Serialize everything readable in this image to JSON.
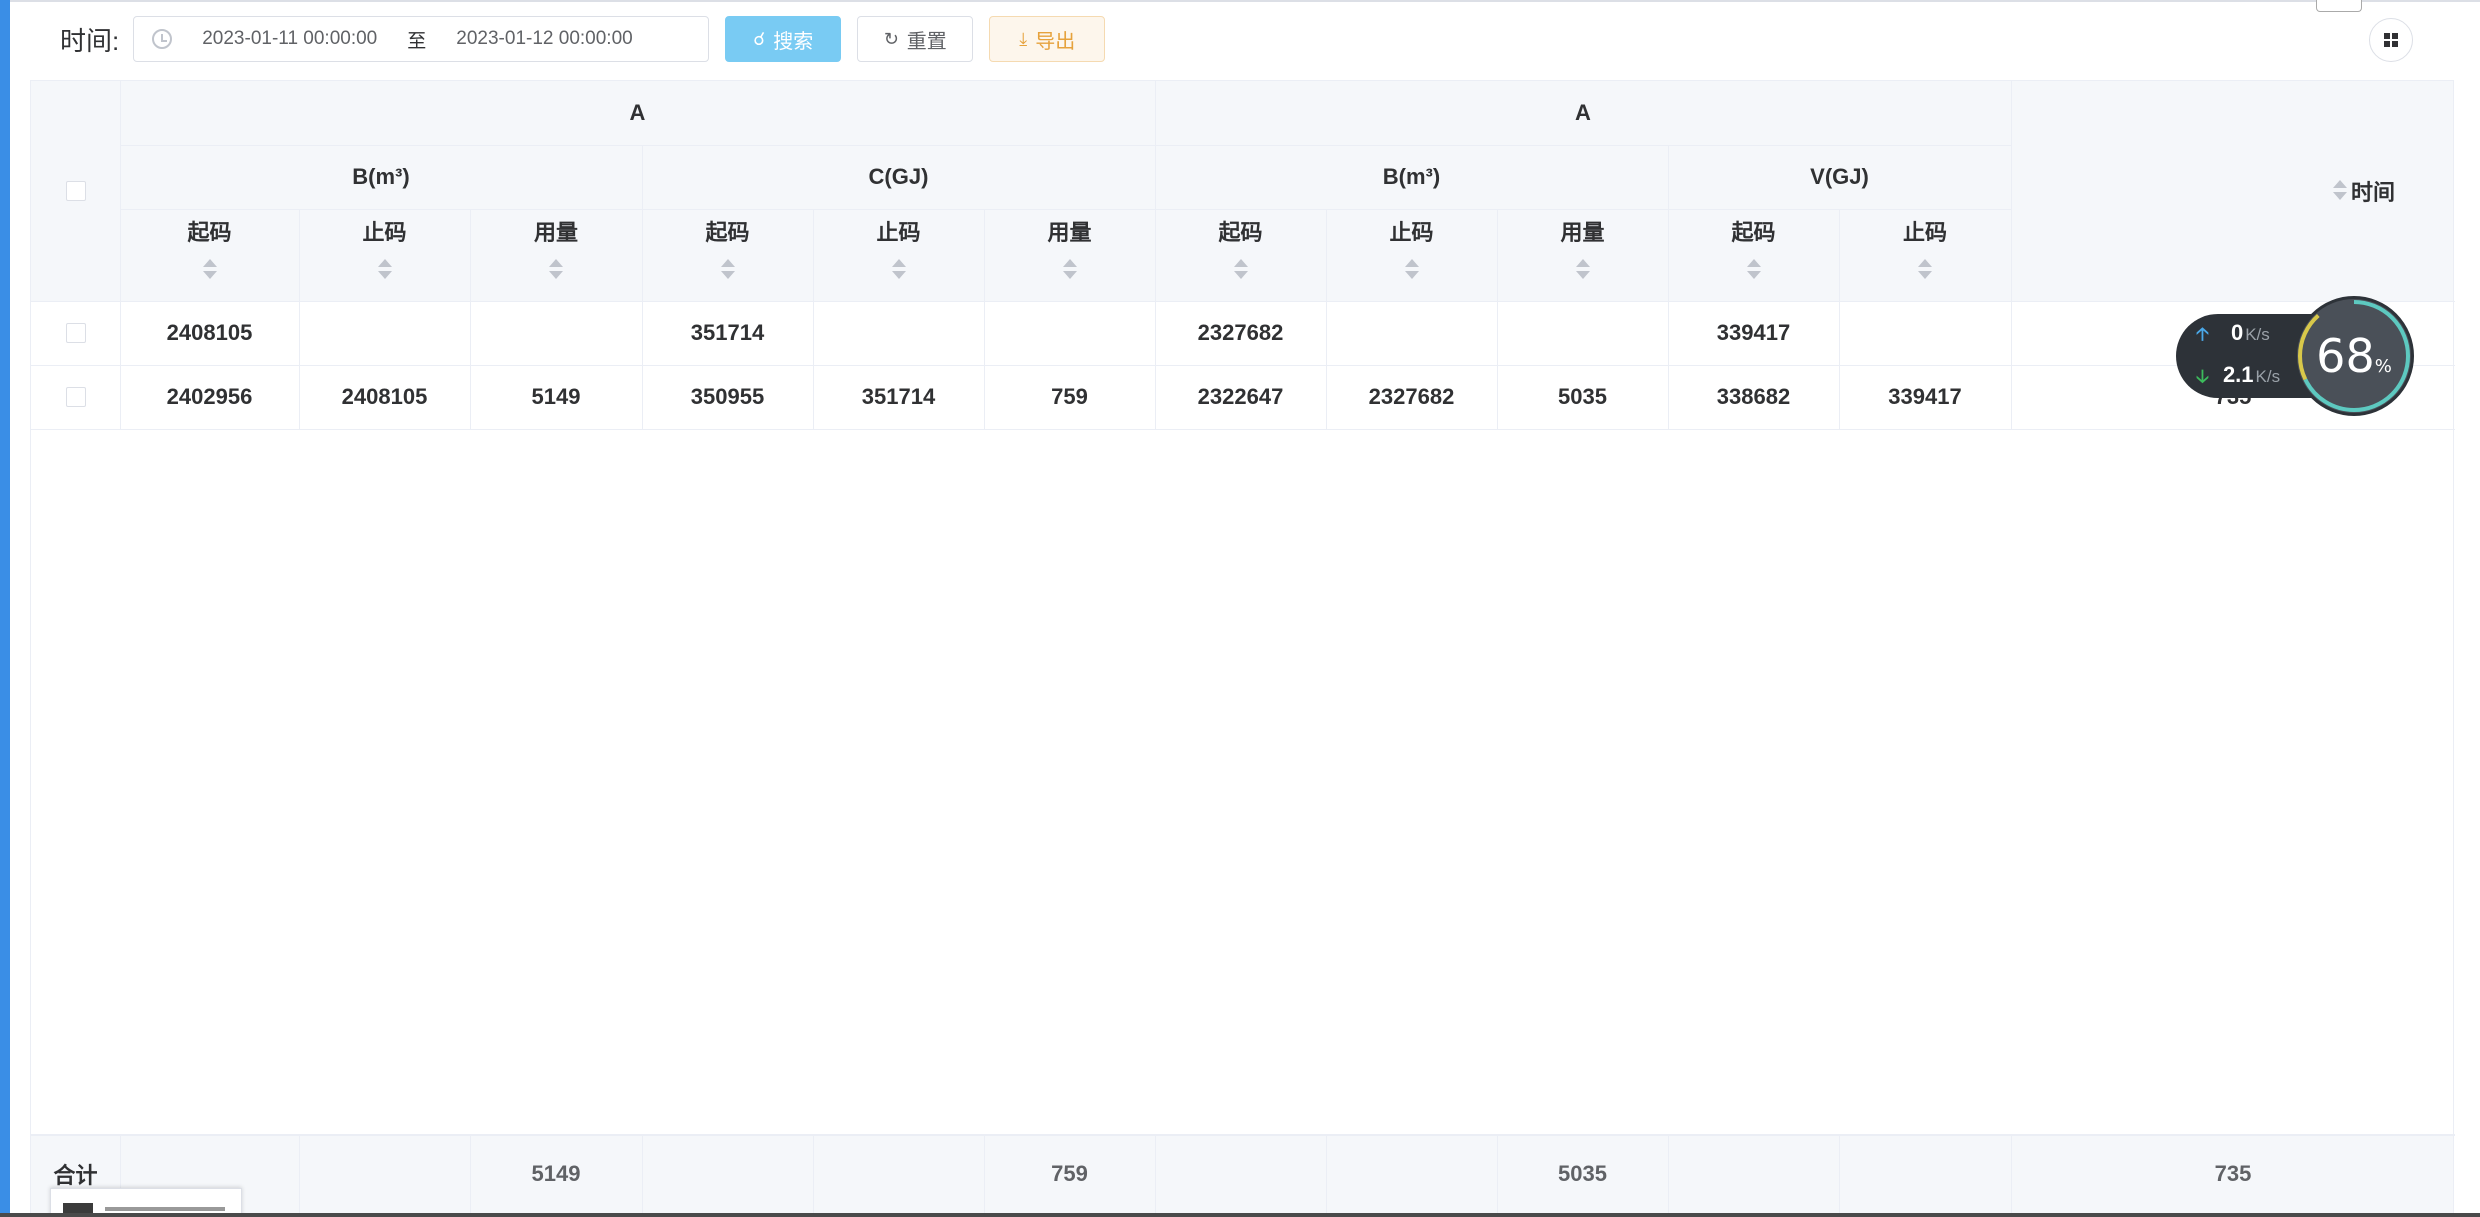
{
  "toolbar": {
    "time_label": "时间:",
    "date_start": "2023-01-11 00:00:00",
    "date_sep": "至",
    "date_end": "2023-01-12 00:00:00",
    "search_label": "搜索",
    "reset_label": "重置",
    "export_label": "导出"
  },
  "table": {
    "group_a1": "A",
    "group_a2": "A",
    "sub_b1": "B(m³)",
    "sub_c": "C(GJ)",
    "sub_b2": "B(m³)",
    "sub_v": "V(GJ)",
    "col_start": "起码",
    "col_end": "止码",
    "col_usage": "用量",
    "col_time": "时间",
    "rows": [
      [
        "2408105",
        "",
        "",
        "351714",
        "",
        "",
        "2327682",
        "",
        "",
        "339417",
        "",
        "",
        ""
      ],
      [
        "2402956",
        "2408105",
        "5149",
        "350955",
        "351714",
        "759",
        "2322647",
        "2327682",
        "5035",
        "338682",
        "339417",
        "735",
        ""
      ]
    ],
    "footer_label": "合计",
    "footer": [
      "",
      "",
      "5149",
      "",
      "",
      "759",
      "",
      "",
      "5035",
      "",
      "",
      "735",
      ""
    ]
  },
  "speed_widget": {
    "up_value": "0",
    "up_unit": "K/s",
    "down_value": "2.1",
    "down_unit": "K/s",
    "percent": "68",
    "percent_sign": "%"
  }
}
